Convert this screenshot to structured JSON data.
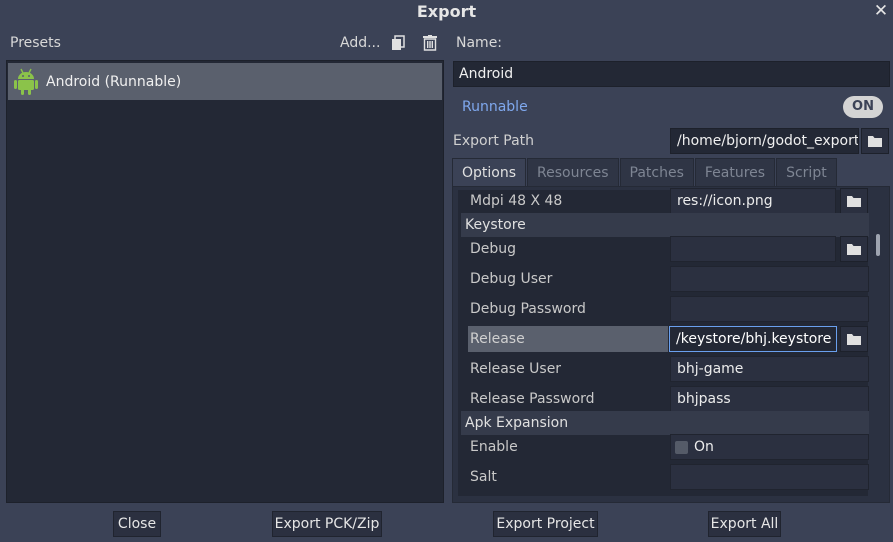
{
  "window": {
    "title": "Export",
    "close_icon": "close-icon"
  },
  "presets": {
    "label": "Presets",
    "add_label": "Add...",
    "items": [
      {
        "label": "Android (Runnable)",
        "icon": "android-icon"
      }
    ]
  },
  "details": {
    "name_label": "Name:",
    "name_value": "Android",
    "runnable_label": "Runnable",
    "runnable_toggle": "ON",
    "export_path_label": "Export Path",
    "export_path_value": "/home/bjorn/godot_export"
  },
  "tabs": [
    {
      "label": "Options",
      "active": true
    },
    {
      "label": "Resources",
      "active": false
    },
    {
      "label": "Patches",
      "active": false
    },
    {
      "label": "Features",
      "active": false
    },
    {
      "label": "Script",
      "active": false
    }
  ],
  "options": {
    "mdpi_label": "Mdpi 48 X 48",
    "mdpi_value": "res://icon.png",
    "keystore_section": "Keystore",
    "debug_label": "Debug",
    "debug_value": "",
    "debug_user_label": "Debug User",
    "debug_user_value": "",
    "debug_password_label": "Debug Password",
    "debug_password_value": "",
    "release_label": "Release",
    "release_value": "/keystore/bhj.keystore",
    "release_user_label": "Release User",
    "release_user_value": "bhj-game",
    "release_password_label": "Release Password",
    "release_password_value": "bhjpass",
    "apk_section": "Apk Expansion",
    "enable_label": "Enable",
    "enable_value": "On",
    "salt_label": "Salt",
    "salt_value": ""
  },
  "buttons": {
    "close": "Close",
    "export_pck": "Export PCK/Zip",
    "export_project": "Export Project",
    "export_all": "Export All"
  },
  "colors": {
    "background": "#3b4256",
    "panel": "#232835",
    "accent": "#7fa8ee",
    "selected": "#5a606d",
    "android_green": "#8bc34a"
  }
}
